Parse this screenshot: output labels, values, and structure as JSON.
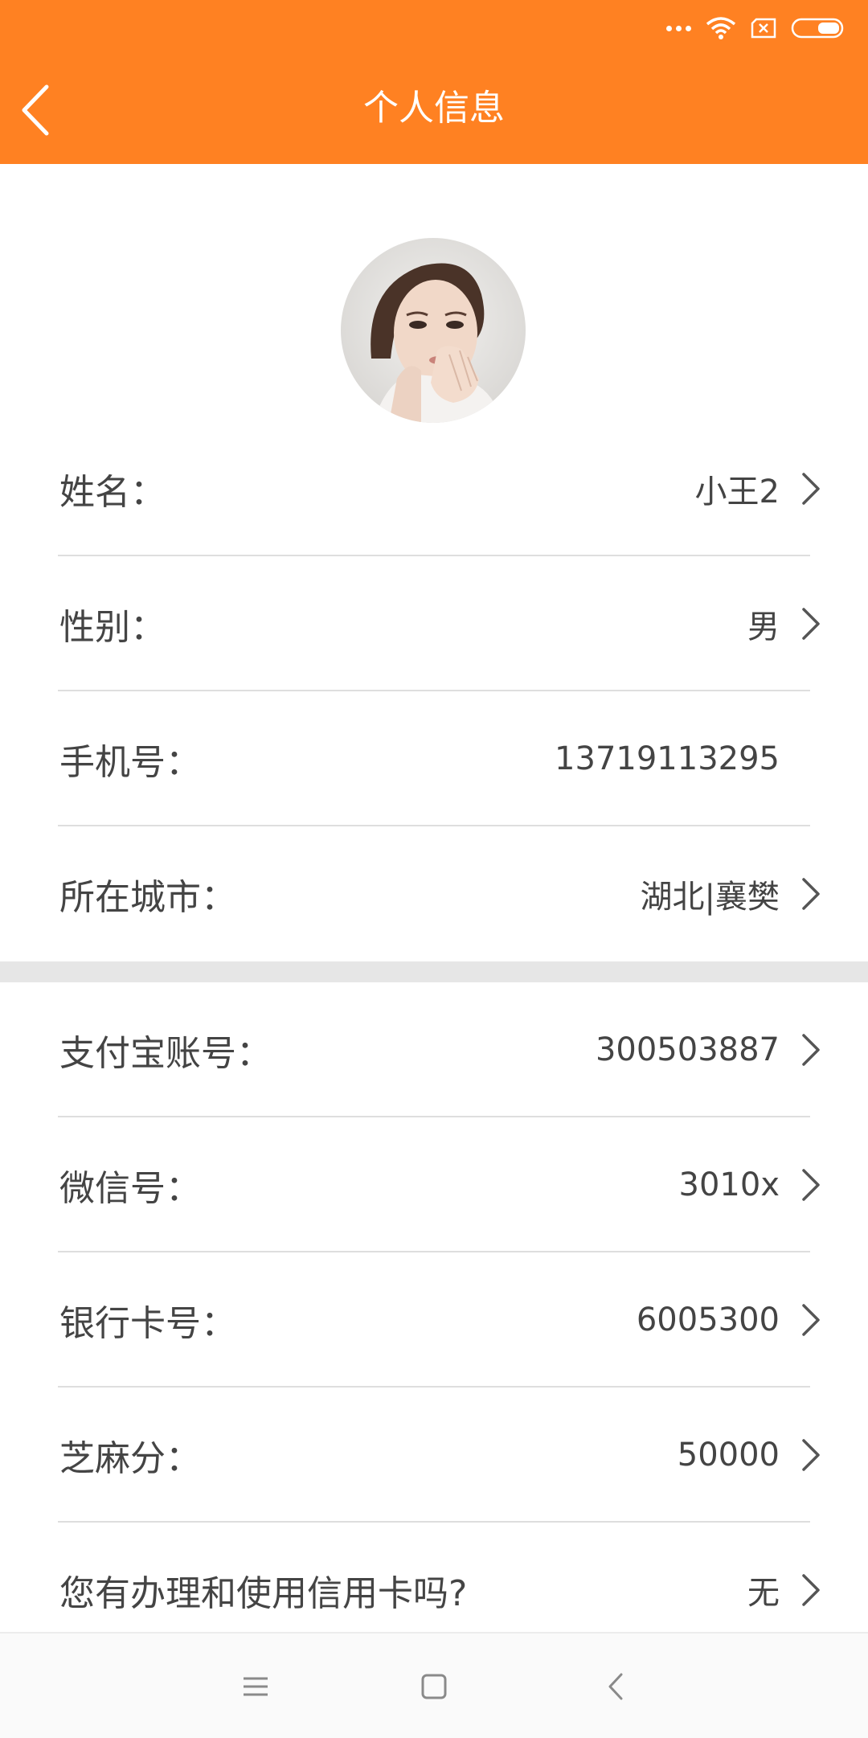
{
  "status_bar": {
    "icons": [
      "more-dots-icon",
      "wifi-icon",
      "sim-x-icon",
      "battery-icon"
    ]
  },
  "header": {
    "title": "个人信息",
    "back_icon": "chevron-left-icon",
    "color": "#ff8122"
  },
  "avatar": {
    "icon": "avatar-photo"
  },
  "section1": {
    "rows": [
      {
        "label": "姓名：",
        "value": "小王2",
        "arrow": true
      },
      {
        "label": "性别：",
        "value": "男",
        "arrow": true
      },
      {
        "label": "手机号：",
        "value": "13719113295",
        "arrow": false
      },
      {
        "label": "所在城市：",
        "value": "湖北|襄樊",
        "arrow": true
      }
    ]
  },
  "section2": {
    "rows": [
      {
        "label": "支付宝账号：",
        "value": "300503887",
        "arrow": true
      },
      {
        "label": "微信号：",
        "value": "3010x",
        "arrow": true
      },
      {
        "label": "银行卡号：",
        "value": "6005300",
        "arrow": true
      },
      {
        "label": "芝麻分：",
        "value": "50000",
        "arrow": true
      },
      {
        "label": "您有办理和使用信用卡吗?",
        "value": "无",
        "arrow": true
      }
    ]
  },
  "nav_bar": {
    "icons": [
      "menu-icon",
      "home-square-icon",
      "back-triangle-icon"
    ]
  }
}
